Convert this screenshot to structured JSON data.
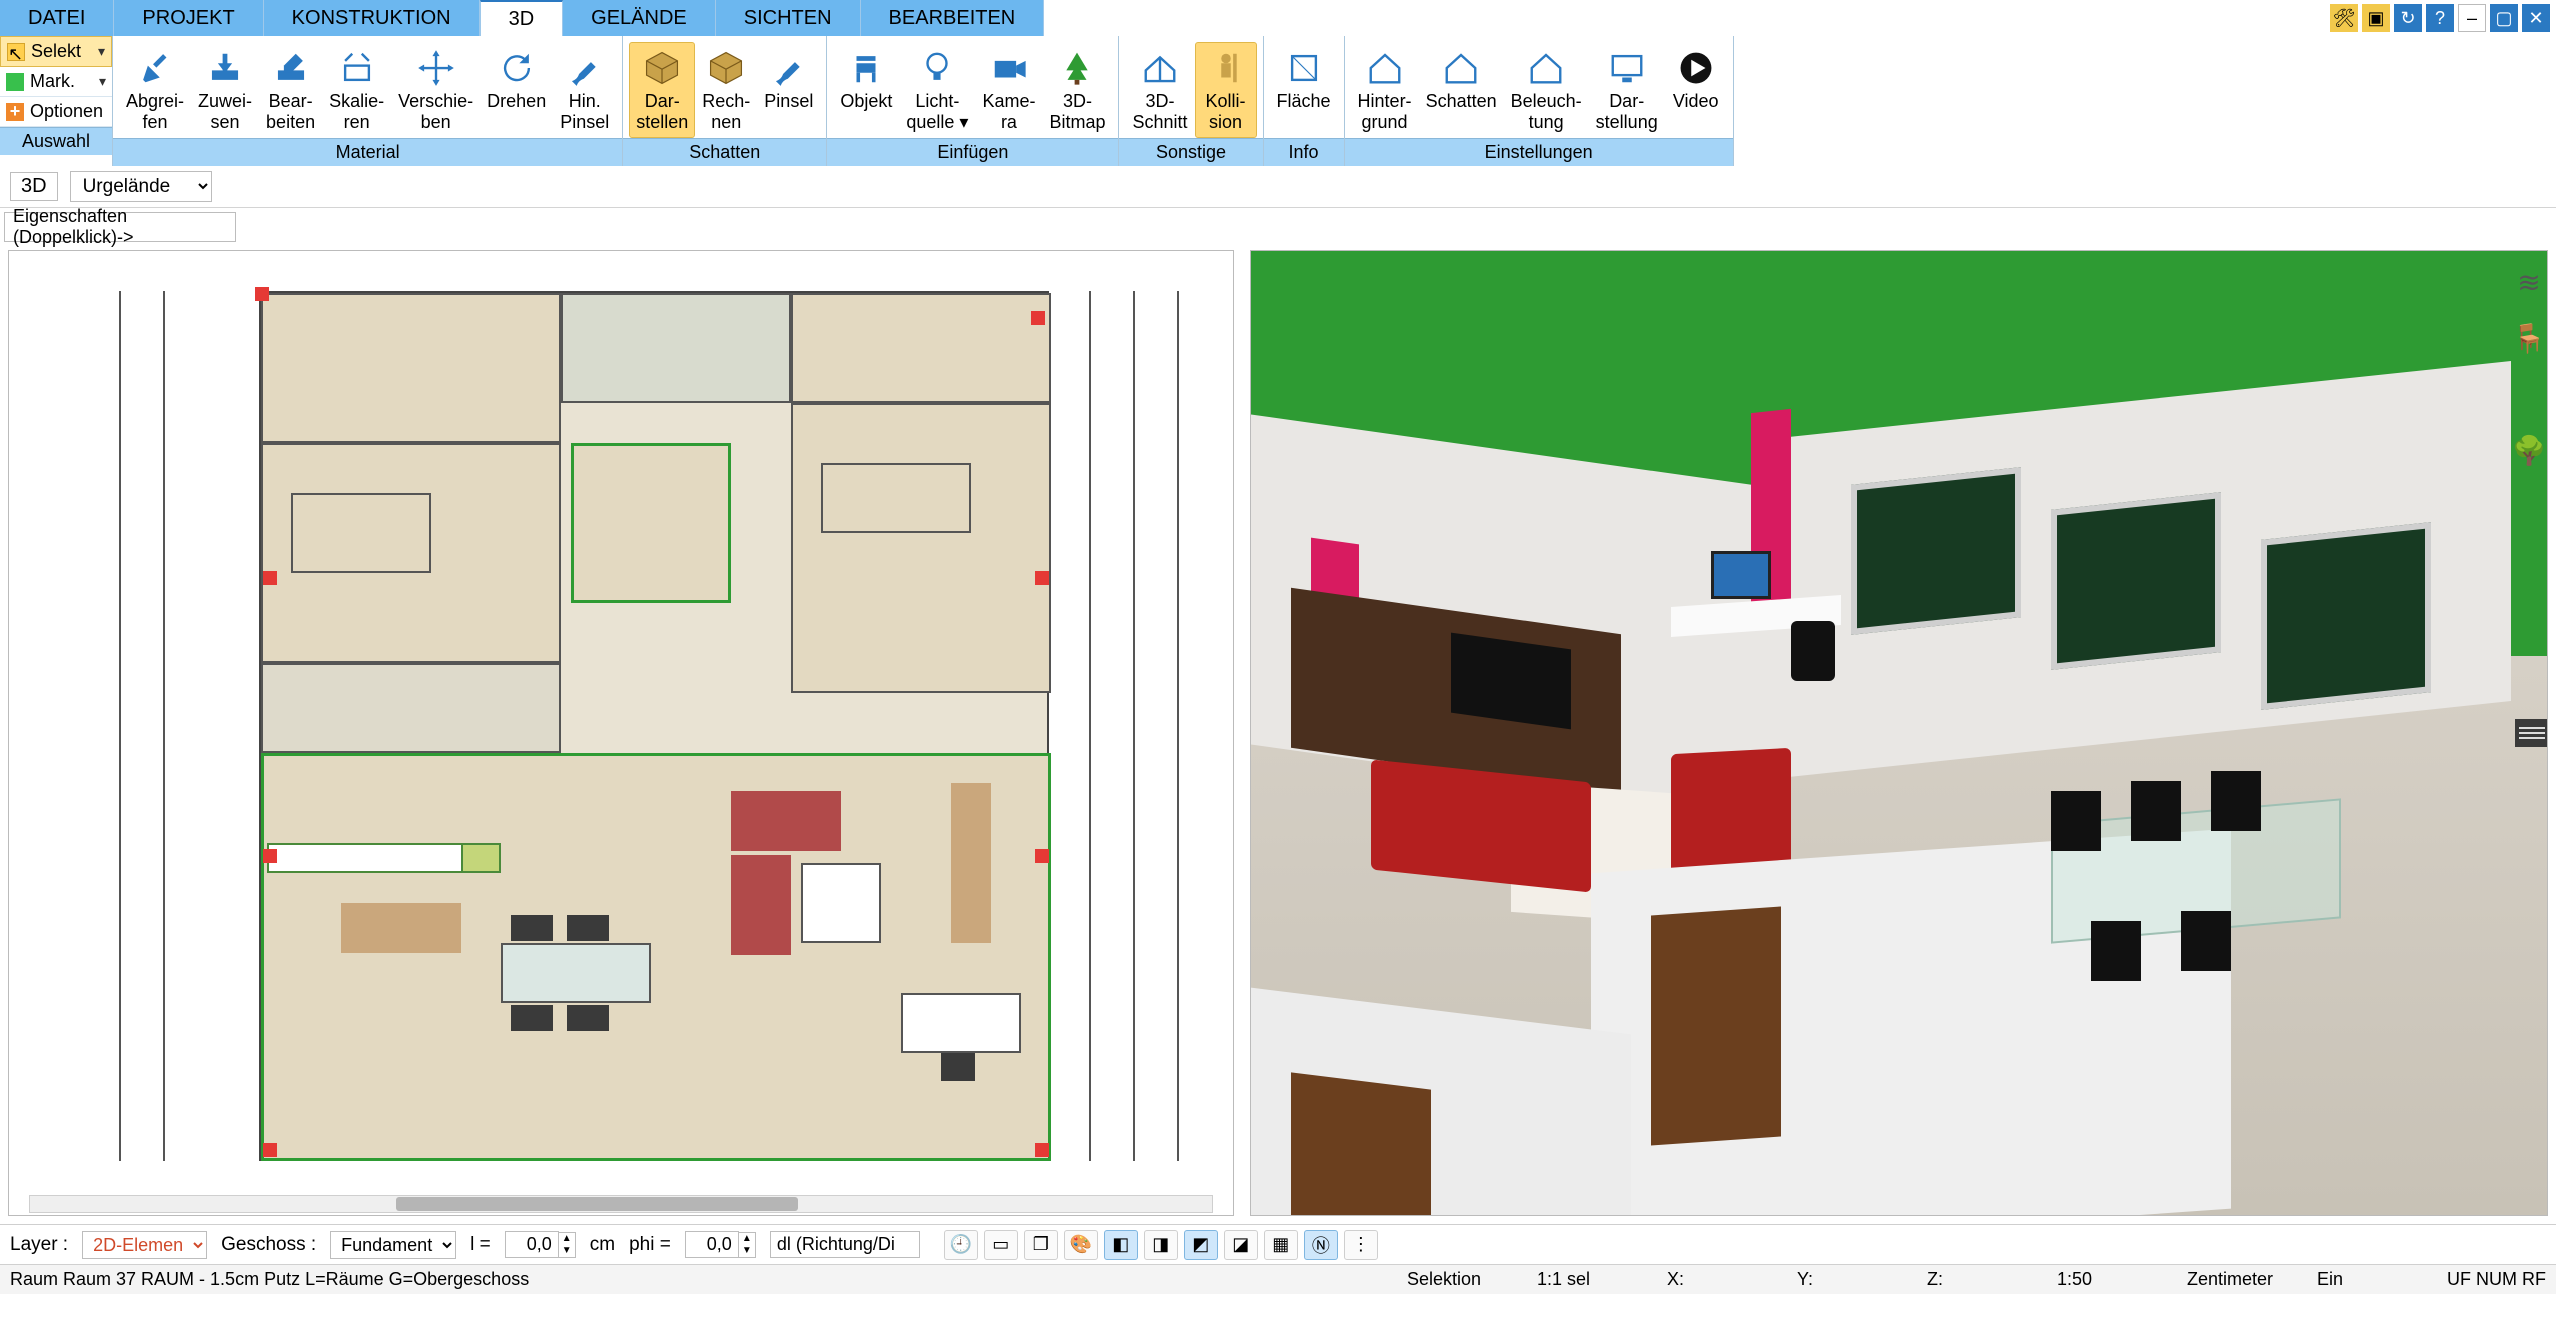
{
  "tabs": {
    "items": [
      "DATEI",
      "PROJEKT",
      "KONSTRUKTION",
      "3D",
      "GELÄNDE",
      "SICHTEN",
      "BEARBEITEN"
    ],
    "active_index": 3
  },
  "selectors": {
    "selekt": "Selekt",
    "mark": "Mark.",
    "optionen": "Optionen",
    "auswahl_label": "Auswahl"
  },
  "ribbon": {
    "groups": [
      {
        "id": "material",
        "label": "Material",
        "buttons": [
          {
            "id": "abgreifen",
            "line1": "Abgrei-",
            "line2": "fen"
          },
          {
            "id": "zuweisen",
            "line1": "Zuwei-",
            "line2": "sen"
          },
          {
            "id": "bearbeiten",
            "line1": "Bear-",
            "line2": "beiten"
          },
          {
            "id": "skalieren",
            "line1": "Skalie-",
            "line2": "ren"
          },
          {
            "id": "verschieben",
            "line1": "Verschie-",
            "line2": "ben"
          },
          {
            "id": "drehen",
            "line1": "Drehen",
            "line2": ""
          },
          {
            "id": "hinpinsel",
            "line1": "Hin.",
            "line2": "Pinsel"
          }
        ]
      },
      {
        "id": "schatten",
        "label": "Schatten",
        "buttons": [
          {
            "id": "darstellen",
            "line1": "Dar-",
            "line2": "stellen",
            "active": true
          },
          {
            "id": "rechnen",
            "line1": "Rech-",
            "line2": "nen"
          },
          {
            "id": "pinsel",
            "line1": "Pinsel",
            "line2": ""
          }
        ]
      },
      {
        "id": "einfuegen",
        "label": "Einfügen",
        "buttons": [
          {
            "id": "objekt",
            "line1": "Objekt",
            "line2": ""
          },
          {
            "id": "lichtquelle",
            "line1": "Licht-",
            "line2": "quelle",
            "dropdown": true
          },
          {
            "id": "kamera",
            "line1": "Kame-",
            "line2": "ra"
          },
          {
            "id": "bitmap3d",
            "line1": "3D-",
            "line2": "Bitmap"
          }
        ]
      },
      {
        "id": "sonstige",
        "label": "Sonstige",
        "buttons": [
          {
            "id": "schnitt3d",
            "line1": "3D-",
            "line2": "Schnitt"
          },
          {
            "id": "kollision",
            "line1": "Kolli-",
            "line2": "sion",
            "active": true
          }
        ]
      },
      {
        "id": "info",
        "label": "Info",
        "buttons": [
          {
            "id": "flaeche",
            "line1": "Fläche",
            "line2": ""
          }
        ]
      },
      {
        "id": "einstellungen",
        "label": "Einstellungen",
        "buttons": [
          {
            "id": "hintergrund",
            "line1": "Hinter-",
            "line2": "grund"
          },
          {
            "id": "schatten2",
            "line1": "Schatten",
            "line2": ""
          },
          {
            "id": "beleuchtung",
            "line1": "Beleuch-",
            "line2": "tung"
          },
          {
            "id": "darstellung",
            "line1": "Dar-",
            "line2": "stellung"
          },
          {
            "id": "video",
            "line1": "Video",
            "line2": ""
          }
        ]
      }
    ]
  },
  "subbar": {
    "mode": "3D",
    "terrain_select": "Urgelände"
  },
  "properties_strip": "Eigenschaften (Doppelklick)->",
  "bottom": {
    "layer_label": "Layer :",
    "layer_value": "2D-Elemen",
    "geschoss_label": "Geschoss :",
    "geschoss_value": "Fundament",
    "l_label": "l =",
    "l_value": "0,0",
    "l_unit": "cm",
    "phi_label": "phi =",
    "phi_value": "0,0",
    "dl_value": "dl (Richtung/Di"
  },
  "status": {
    "left": "Raum Raum 37 RAUM - 1.5cm Putz L=Räume G=Obergeschoss",
    "selektion": "Selektion",
    "sel_count": "1:1 sel",
    "x": "X:",
    "y": "Y:",
    "z": "Z:",
    "scale": "1:50",
    "unit": "Zentimeter",
    "ein": "Ein",
    "flags": "UF NUM RF"
  },
  "icons": {
    "abgreifen": "eyedropper-icon",
    "zuweisen": "apply-icon",
    "bearbeiten": "edit-icon",
    "skalieren": "scale-icon",
    "verschieben": "move-icon",
    "drehen": "rotate-icon",
    "hinpinsel": "add-brush-icon",
    "darstellen": "cube-icon",
    "rechnen": "cube-calc-icon",
    "pinsel": "brush-icon",
    "objekt": "chair-icon",
    "lichtquelle": "bulb-icon",
    "kamera": "camera-icon",
    "bitmap3d": "tree-icon",
    "schnitt3d": "section-icon",
    "kollision": "person-icon",
    "flaeche": "area-icon",
    "hintergrund": "house-bg-icon",
    "schatten2": "house-shadow-icon",
    "beleuchtung": "house-light-icon",
    "darstellung": "monitor-icon",
    "video": "play-icon"
  }
}
